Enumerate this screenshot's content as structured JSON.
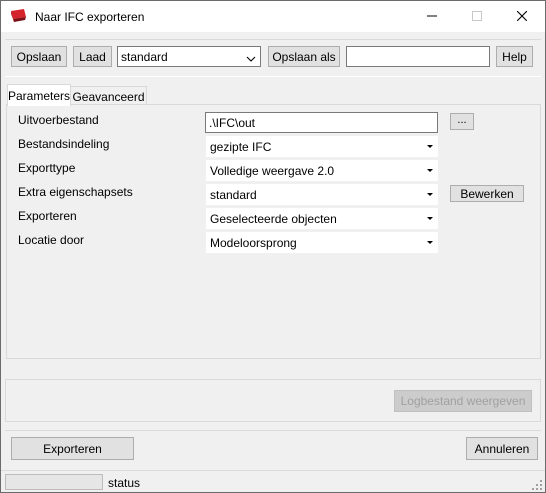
{
  "window": {
    "title": "Naar IFC exporteren"
  },
  "toolbar": {
    "save_label": "Opslaan",
    "load_label": "Laad",
    "preset_value": "standard",
    "save_as_label": "Opslaan als",
    "save_as_value": "",
    "help_label": "Help"
  },
  "tabs": [
    {
      "label": "Parameters",
      "active": true
    },
    {
      "label": "Geavanceerd",
      "active": false
    }
  ],
  "parameters": {
    "output_file": {
      "label": "Uitvoerbestand",
      "value": ".\\IFC\\out",
      "browse_label": "..."
    },
    "file_format": {
      "label": "Bestandsindeling",
      "value": "gezipte IFC"
    },
    "export_type": {
      "label": "Exporttype",
      "value": "Volledige weergave 2.0"
    },
    "property_sets": {
      "label": "Extra eigenschapsets",
      "value": "standard",
      "edit_label": "Bewerken"
    },
    "export": {
      "label": "Exporteren",
      "value": "Geselecteerde objecten"
    },
    "location": {
      "label": "Locatie door",
      "value": "Modeloorsprong"
    }
  },
  "log": {
    "show_log_label": "Logbestand weergeven"
  },
  "footer": {
    "export_label": "Exporteren",
    "cancel_label": "Annuleren"
  },
  "status": {
    "text": "status"
  },
  "colors": {
    "app_icon_red": "#d4232b",
    "window_bg": "#f0f0f0",
    "button_bg": "#e1e1e1",
    "button_border": "#adadad"
  }
}
